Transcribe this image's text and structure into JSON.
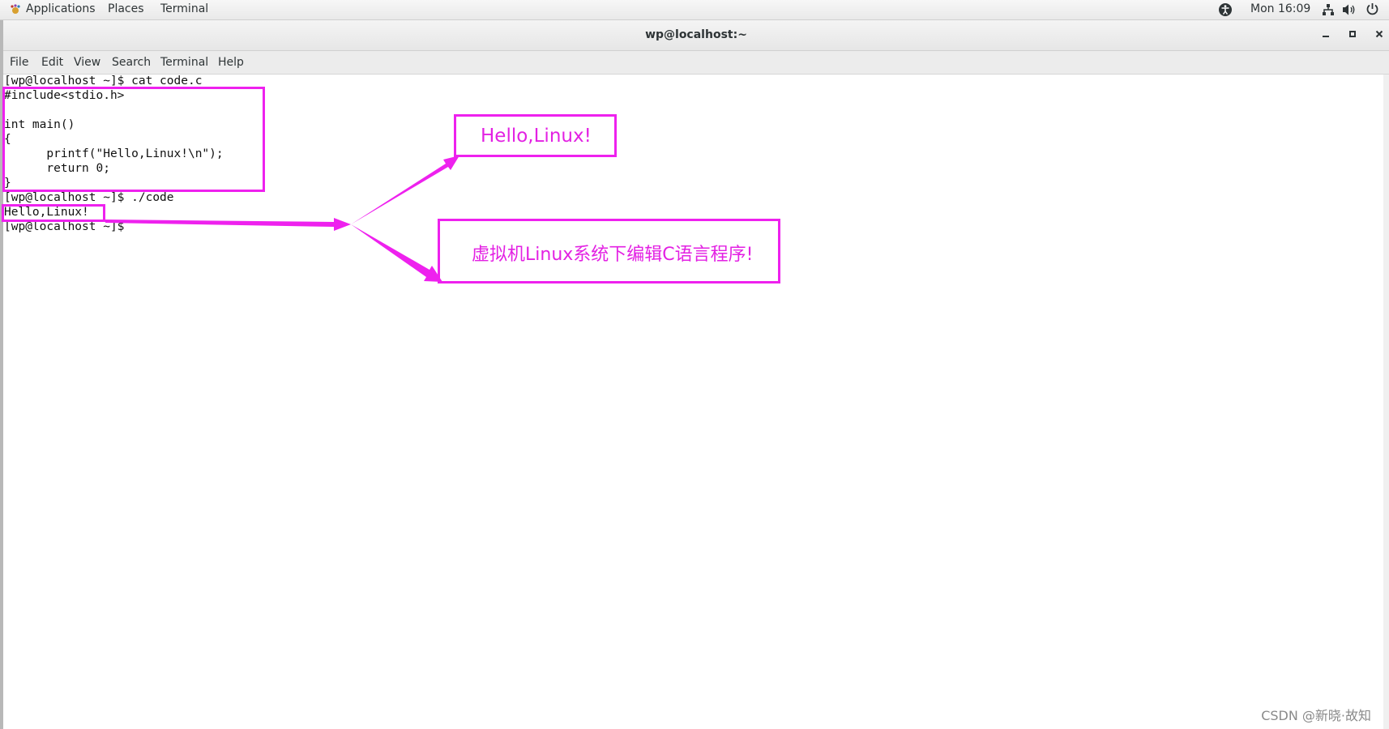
{
  "top_panel": {
    "applications": "Applications",
    "places": "Places",
    "terminal": "Terminal",
    "clock": "Mon 16:09",
    "icons": [
      "accessibility-icon",
      "network-icon",
      "volume-icon",
      "power-icon"
    ]
  },
  "window": {
    "title": "wp@localhost:~",
    "buttons": [
      "minimize",
      "maximize",
      "close"
    ]
  },
  "menu": {
    "items": [
      "File",
      "Edit",
      "View",
      "Search",
      "Terminal",
      "Help"
    ]
  },
  "terminal": {
    "lines": [
      "[wp@localhost ~]$ cat code.c",
      "#include<stdio.h>",
      "",
      "int main()",
      "{",
      "      printf(\"Hello,Linux!\\n\");",
      "      return 0;",
      "}",
      "[wp@localhost ~]$ ./code",
      "Hello,Linux!",
      "[wp@localhost ~]$"
    ]
  },
  "annotations": {
    "output_label": "Hello,Linux!",
    "caption": "虚拟机Linux系统下编辑C语言程序!",
    "color": "#ee21ee"
  },
  "watermark": "CSDN @新晓·故知"
}
